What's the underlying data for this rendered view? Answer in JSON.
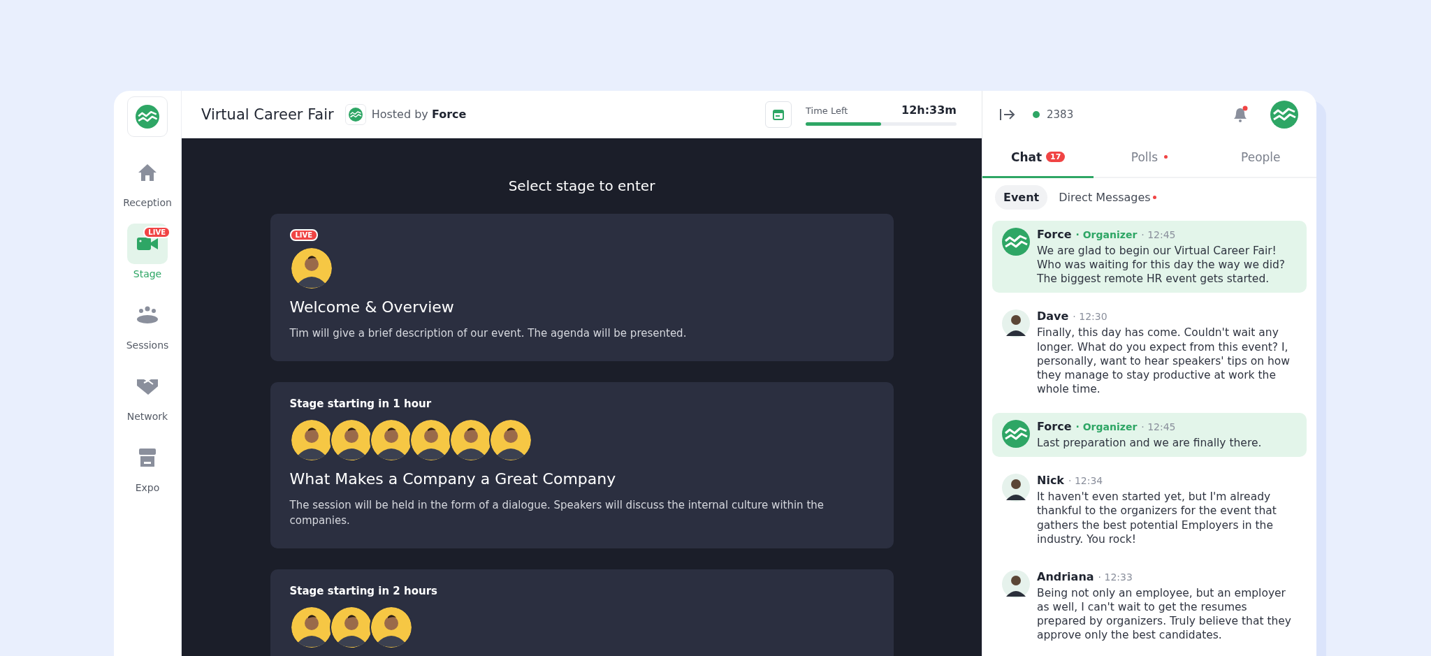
{
  "header": {
    "title": "Virtual Career Fair",
    "host_prefix": "Hosted by",
    "host": "Force",
    "time_label": "Time Left",
    "time_value": "12h:33m",
    "level": 0.5
  },
  "sidebar": {
    "items": [
      {
        "label": "Reception",
        "kind": "home",
        "selected": false
      },
      {
        "label": "Stage",
        "kind": "camera",
        "selected": true,
        "badge": "LIVE"
      },
      {
        "label": "Sessions",
        "kind": "group",
        "selected": false
      },
      {
        "label": "Network",
        "kind": "handshake",
        "selected": false
      },
      {
        "label": "Expo",
        "kind": "stand",
        "selected": false
      }
    ]
  },
  "stage": {
    "heading": "Select stage to enter",
    "cards": [
      {
        "badge": "LIVE",
        "title": "Welcome & Overview",
        "description": "Tim will give a brief description of our event. The agenda will be presented."
      },
      {
        "status": "Stage starting in 1 hour",
        "title": "What Makes a Company a Great Company",
        "description": "The session will be held in the form of a dialogue. Speakers will discuss the internal culture within the companies."
      },
      {
        "status": "Stage starting in 2 hours"
      }
    ]
  },
  "chat_panel": {
    "online_count": "2383",
    "notification_unread": true,
    "tabs": [
      {
        "label": "Chat",
        "badge": "17",
        "dot": false,
        "selected": true
      },
      {
        "label": "Polls",
        "dot": true,
        "selected": false
      },
      {
        "label": "People",
        "dot": false,
        "selected": false
      }
    ],
    "subtabs": [
      {
        "label": "Event",
        "dot": false,
        "selected": true
      },
      {
        "label": "Direct Messages",
        "dot": true,
        "selected": false
      }
    ],
    "messages": [
      {
        "kind": "logo",
        "author": "Force",
        "role": "· Organizer",
        "time": "· 12:45",
        "highlighted": true,
        "text": "We are glad to begin our Virtual Career Fair! Who was waiting for this day the way we did? The biggest remote HR event gets started."
      },
      {
        "kind": "person",
        "author": "Dave",
        "time": "· 12:30",
        "highlighted": false,
        "text": "Finally, this day has come. Couldn't wait any longer. What do you expect from this event? I, personally, want to hear speakers' tips on how they manage to stay productive at work the whole time."
      },
      {
        "kind": "logo",
        "author": "Force",
        "role": "· Organizer",
        "time": "· 12:45",
        "highlighted": true,
        "text": "Last preparation and we are finally there."
      },
      {
        "kind": "person",
        "author": "Nick",
        "time": "· 12:34",
        "highlighted": false,
        "text": "It haven't even started yet, but I'm already thankful to the organizers for the event that gathers the best potential Employers in the industry. You rock!"
      },
      {
        "kind": "person",
        "author": "Andriana",
        "time": "· 12:33",
        "highlighted": false,
        "text": "Being not only an employee, but an employer as well, I can't wait to get the resumes prepared by organizers. Truly believe that they approve only the best candidates."
      }
    ]
  }
}
